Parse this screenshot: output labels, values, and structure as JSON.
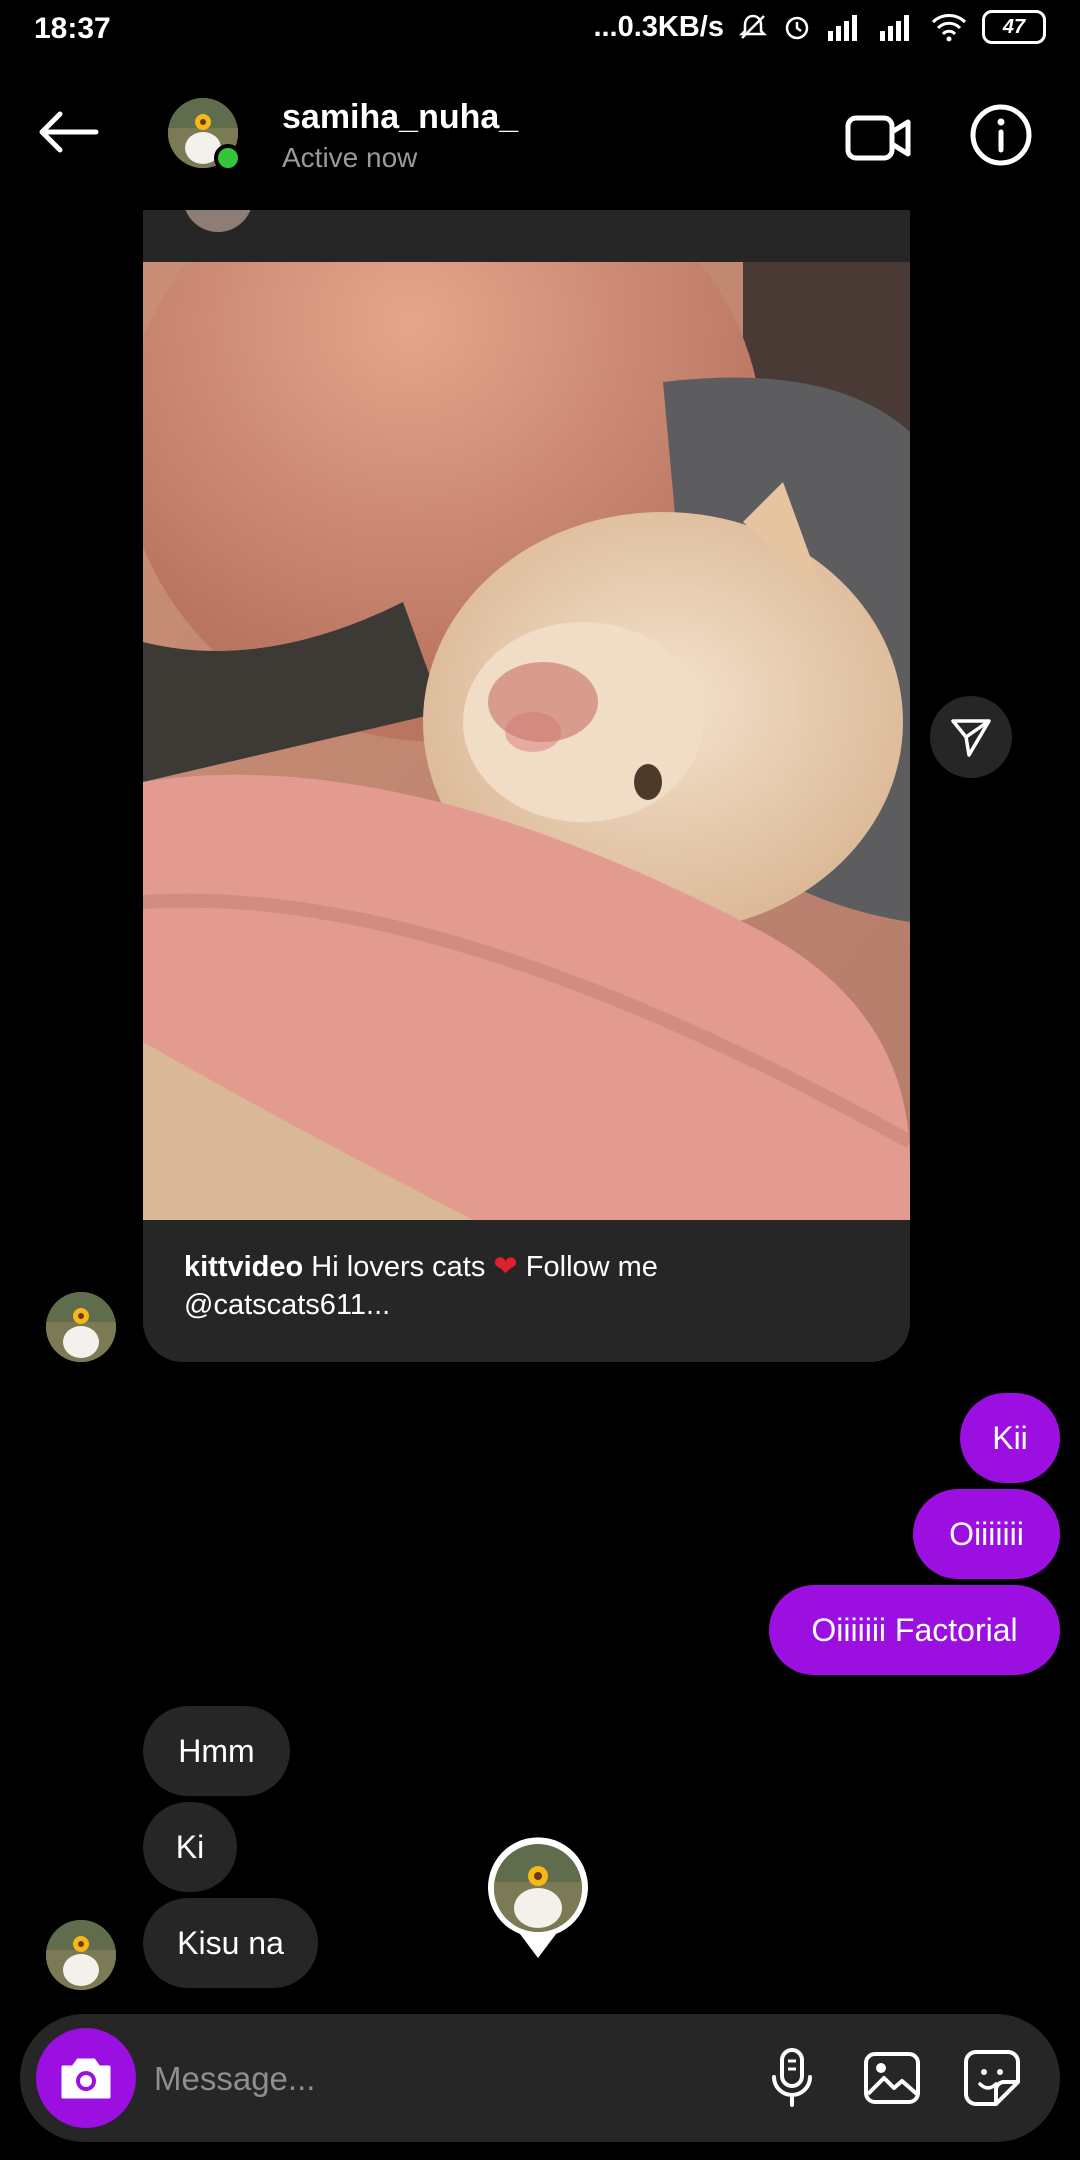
{
  "status_bar": {
    "time": "18:37",
    "network_speed": "...0.3KB/s",
    "battery": "47"
  },
  "header": {
    "username": "samiha_nuha_",
    "status": "Active now"
  },
  "post": {
    "account": "kittvideo",
    "caption_before_heart": " Hi lovers cats ",
    "heart": "❤",
    "caption_after_heart": " Follow me",
    "caption_line2": "@catscats611..."
  },
  "messages": {
    "sent": [
      "Kii",
      "Oiiiiiii",
      "Oiiiiiii Factorial"
    ],
    "received": [
      "Hmm",
      "Ki",
      "Kisu na"
    ]
  },
  "composer": {
    "placeholder": "Message..."
  },
  "colors": {
    "accent": "#9b0fe0",
    "bubble_received": "#262626",
    "online": "#35c53a"
  }
}
